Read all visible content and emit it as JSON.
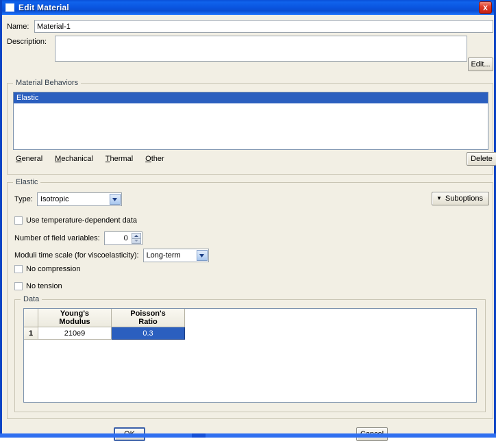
{
  "window": {
    "title": "Edit Material",
    "title_icon": "window-icon",
    "close_icon": "close-icon",
    "accent_color": "#0b44c4",
    "titlebar_color": "#0a50d8",
    "background_color": "#f2efe4",
    "selection_color": "#2b5fbf"
  },
  "form": {
    "name_label": "Name:",
    "name_value": "Material-1",
    "name_placeholder": "",
    "description_label": "Description:",
    "description_value": "",
    "description_placeholder": "",
    "edit_button": "Edit..."
  },
  "material_behaviors": {
    "group_title": "Material Behaviors",
    "items": [
      {
        "label": "Elastic",
        "selected": true
      }
    ],
    "menu": [
      {
        "label": "General",
        "mnemonic": "G"
      },
      {
        "label": "Mechanical",
        "mnemonic": "M"
      },
      {
        "label": "Thermal",
        "mnemonic": "T"
      },
      {
        "label": "Other",
        "mnemonic": "O"
      }
    ],
    "delete_button": "Delete"
  },
  "elastic": {
    "group_title": "Elastic",
    "type_label": "Type:",
    "type_value": "Isotropic",
    "type_options": [
      "Isotropic"
    ],
    "suboptions_button": "Suboptions",
    "suboptions_caret": "▼",
    "use_temp_dependent_label": "Use temperature-dependent data",
    "use_temp_dependent_checked": false,
    "field_variables_label": "Number of field variables:",
    "field_variables_value": "0",
    "moduli_label": "Moduli time scale (for viscoelasticity):",
    "moduli_value": "Long-term",
    "moduli_options": [
      "Long-term"
    ],
    "no_compression_label": "No compression",
    "no_compression_checked": false,
    "no_tension_label": "No tension",
    "no_tension_checked": false
  },
  "data": {
    "group_title": "Data",
    "columns": [
      "Young's\nModulus",
      "Poisson's\nRatio"
    ],
    "column_lines": [
      [
        "Young's",
        "Modulus"
      ],
      [
        "Poisson's",
        "Ratio"
      ]
    ],
    "rows": [
      {
        "index": "1",
        "youngs_modulus": "210e9",
        "poissons_ratio": "0.3"
      }
    ],
    "selected_cell": {
      "row": 1,
      "column": "Poisson's Ratio"
    }
  },
  "footer": {
    "ok_button": "OK",
    "cancel_button": "Cancel"
  }
}
